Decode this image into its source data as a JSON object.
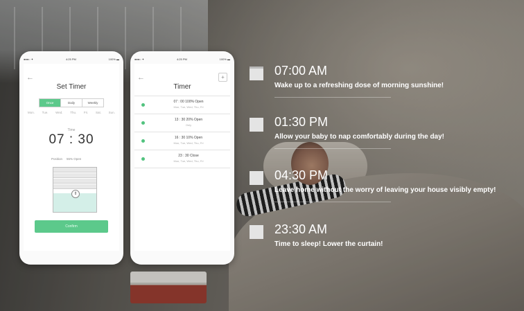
{
  "set_timer_phone": {
    "status": {
      "time": "4:25 PM",
      "battery": "100%"
    },
    "title": "Set Timer",
    "tabs": [
      {
        "label": "Once",
        "active": true
      },
      {
        "label": "Daily",
        "active": false
      },
      {
        "label": "Weekly",
        "active": false
      }
    ],
    "days": [
      "Mon.",
      "Tue.",
      "Wed.",
      "Thu.",
      "Fri.",
      "Sat.",
      "Sun."
    ],
    "time_label": "Time",
    "time_value": "07 : 30",
    "position_label": "Position",
    "position_value": "55% Open",
    "curtain_open_fraction": 0.55,
    "confirm_label": "Confirm"
  },
  "timer_phone": {
    "status": {
      "time": "4:25 PM",
      "battery": "100%"
    },
    "title": "Timer",
    "rows": [
      {
        "main": "07 : 00    100% Open",
        "sub": "Mon, Tue, Wed, Thu, Fri"
      },
      {
        "main": "13 : 30    20% Open",
        "sub": "Only"
      },
      {
        "main": "16 : 30    10% Open",
        "sub": "Mon, Tue, Wed, Thu, Fri"
      },
      {
        "main": "23 : 30    Close",
        "sub": "Mon, Tue, Wed, Thu, Fri"
      }
    ]
  },
  "schedule": [
    {
      "time": "07:00 AM",
      "desc": "Wake up to a refreshing dose of morning sunshine!"
    },
    {
      "time": "01:30 PM",
      "desc": "Allow your baby to nap comfortably during the day!"
    },
    {
      "time": "04:30 PM",
      "desc": "Leave home without the worry of leaving your house visibly empty!"
    },
    {
      "time": "23:30 AM",
      "desc": "Time to sleep! Lower the curtain!"
    }
  ],
  "colors": {
    "accent_green": "#5cc98b",
    "dot_green": "#52c37f"
  }
}
